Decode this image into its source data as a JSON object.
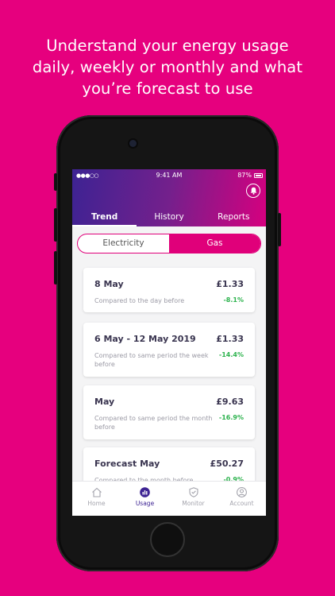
{
  "headline": {
    "line1": "Understand your energy usage",
    "line2": "daily, weekly or monthly and what",
    "line3": "you’re forecast to use"
  },
  "status_bar": {
    "signal": "●●●○○",
    "time": "9:41 AM",
    "battery": "87%"
  },
  "icons": {
    "bell": "bell-icon",
    "home": "home-icon",
    "usage": "usage-icon",
    "monitor": "shield-icon",
    "account": "account-icon"
  },
  "tabs": [
    {
      "label": "Trend"
    },
    {
      "label": "History"
    },
    {
      "label": "Reports"
    }
  ],
  "fuel_toggle": {
    "electricity": "Electricity",
    "gas": "Gas"
  },
  "cards": [
    {
      "title": "8 May",
      "amount": "£1.33",
      "comparison": "Compared to the day before",
      "change": "-8.1%"
    },
    {
      "title": "6 May - 12 May 2019",
      "amount": "£1.33",
      "comparison": "Compared to same period the week before",
      "change": "-14.4%"
    },
    {
      "title": "May",
      "amount": "£9.63",
      "comparison": "Compared to same period the month before",
      "change": "-16.9%"
    },
    {
      "title": "Forecast May",
      "amount": "£50.27",
      "comparison": "Compared to the month before",
      "change": "-0.9%"
    }
  ],
  "bottom_nav": [
    {
      "label": "Home"
    },
    {
      "label": "Usage"
    },
    {
      "label": "Monitor"
    },
    {
      "label": "Account"
    }
  ],
  "colors": {
    "background": "#e6007e",
    "header_start": "#3d2393",
    "header_end": "#d6007f",
    "accent": "#e0007a",
    "positive_change": "#2bb24c",
    "text_dark": "#3a3550"
  }
}
